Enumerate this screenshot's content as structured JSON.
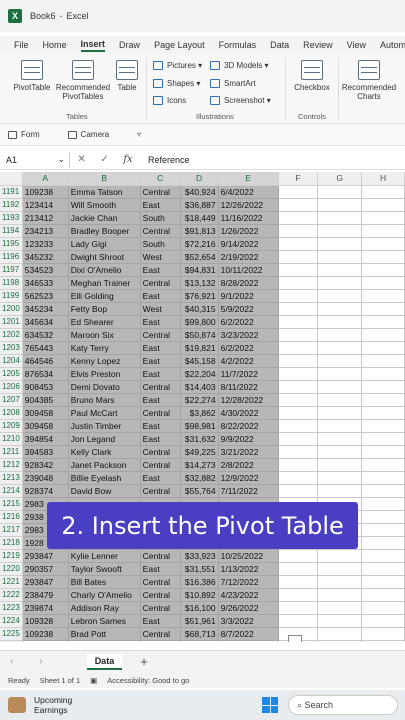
{
  "window": {
    "file_name": "Book6",
    "app_name": "Excel"
  },
  "tabs": [
    "File",
    "Home",
    "Insert",
    "Draw",
    "Page Layout",
    "Formulas",
    "Data",
    "Review",
    "View",
    "Automate"
  ],
  "active_tab": "Insert",
  "ribbon": {
    "pivot_table": "PivotTable",
    "recommended_pivot": "Recommended PivotTables",
    "table": "Table",
    "tables_group": "Tables",
    "pictures": "Pictures",
    "shapes": "Shapes",
    "icons": "Icons",
    "models_3d": "3D Models",
    "smartart": "SmartArt",
    "screenshot": "Screenshot",
    "illustrations_group": "Illustrations",
    "checkbox": "Checkbox",
    "controls_group": "Controls",
    "recommended_charts": "Recommended Charts"
  },
  "quick_bar": {
    "form": "Form",
    "camera": "Camera"
  },
  "formula_bar": {
    "name_box": "A1",
    "formula": "Reference"
  },
  "columns": [
    "A",
    "B",
    "C",
    "D",
    "E",
    "F",
    "G",
    "H"
  ],
  "rows": [
    {
      "n": "1191",
      "a": "109238",
      "b": "Emma Tatson",
      "c": "Central",
      "d": "$40,924",
      "e": "6/4/2022"
    },
    {
      "n": "1192",
      "a": "123414",
      "b": "Will Smooth",
      "c": "East",
      "d": "$36,887",
      "e": "12/26/2022"
    },
    {
      "n": "1193",
      "a": "213412",
      "b": "Jackie Chan",
      "c": "South",
      "d": "$18,449",
      "e": "11/16/2022"
    },
    {
      "n": "1194",
      "a": "234213",
      "b": "Bradley Booper",
      "c": "Central",
      "d": "$91,813",
      "e": "1/26/2022"
    },
    {
      "n": "1195",
      "a": "123233",
      "b": "Lady Gigi",
      "c": "South",
      "d": "$72,216",
      "e": "9/14/2022"
    },
    {
      "n": "1196",
      "a": "345232",
      "b": "Dwight Shroot",
      "c": "West",
      "d": "$52,654",
      "e": "2/19/2022"
    },
    {
      "n": "1197",
      "a": "534523",
      "b": "Dixi O'Amelio",
      "c": "East",
      "d": "$94,831",
      "e": "10/11/2022"
    },
    {
      "n": "1198",
      "a": "346533",
      "b": "Meghan Trainer",
      "c": "Central",
      "d": "$13,132",
      "e": "8/28/2022"
    },
    {
      "n": "1199",
      "a": "562523",
      "b": "Elli Golding",
      "c": "East",
      "d": "$76,921",
      "e": "9/1/2022"
    },
    {
      "n": "1200",
      "a": "345234",
      "b": "Fetty Bop",
      "c": "West",
      "d": "$40,315",
      "e": "5/9/2022"
    },
    {
      "n": "1201",
      "a": "345634",
      "b": "Ed Shearer",
      "c": "East",
      "d": "$99,800",
      "e": "6/2/2022"
    },
    {
      "n": "1202",
      "a": "634532",
      "b": "Maroon Six",
      "c": "Central",
      "d": "$50,874",
      "e": "3/23/2022"
    },
    {
      "n": "1203",
      "a": "765443",
      "b": "Katy Terry",
      "c": "East",
      "d": "$19,821",
      "e": "6/2/2022"
    },
    {
      "n": "1204",
      "a": "464546",
      "b": "Kenny Lopez",
      "c": "East",
      "d": "$45,158",
      "e": "4/2/2022"
    },
    {
      "n": "1205",
      "a": "876534",
      "b": "Elvis Preston",
      "c": "East",
      "d": "$22,204",
      "e": "11/7/2022"
    },
    {
      "n": "1206",
      "a": "908453",
      "b": "Demi Dovato",
      "c": "Central",
      "d": "$14,403",
      "e": "8/11/2022"
    },
    {
      "n": "1207",
      "a": "904385",
      "b": "Bruno Mars",
      "c": "East",
      "d": "$22,274",
      "e": "12/28/2022"
    },
    {
      "n": "1208",
      "a": "309458",
      "b": "Paul McCart",
      "c": "Central",
      "d": "$3,862",
      "e": "4/30/2022"
    },
    {
      "n": "1209",
      "a": "309458",
      "b": "Justin Timber",
      "c": "East",
      "d": "$98,981",
      "e": "8/22/2022"
    },
    {
      "n": "1210",
      "a": "394854",
      "b": "Jon Legand",
      "c": "East",
      "d": "$31,632",
      "e": "9/9/2022"
    },
    {
      "n": "1211",
      "a": "394583",
      "b": "Kelly Clark",
      "c": "Central",
      "d": "$49,225",
      "e": "3/21/2022"
    },
    {
      "n": "1212",
      "a": "928342",
      "b": "Janet Packson",
      "c": "Central",
      "d": "$14,273",
      "e": "2/8/2022"
    },
    {
      "n": "1213",
      "a": "239048",
      "b": "Billie Eyelash",
      "c": "East",
      "d": "$32,882",
      "e": "12/9/2022"
    },
    {
      "n": "1214",
      "a": "928374",
      "b": "David Bow",
      "c": "Central",
      "d": "$55,764",
      "e": "7/11/2022"
    },
    {
      "n": "1215",
      "a": "2983",
      "b": "",
      "c": "",
      "d": "",
      "e": ""
    },
    {
      "n": "1216",
      "a": "2938",
      "b": "",
      "c": "",
      "d": "",
      "e": ""
    },
    {
      "n": "1217",
      "a": "2983",
      "b": "",
      "c": "",
      "d": "",
      "e": ""
    },
    {
      "n": "1218",
      "a": "1928",
      "b": "",
      "c": "",
      "d": "",
      "e": ""
    },
    {
      "n": "1219",
      "a": "293847",
      "b": "Kylie Lenner",
      "c": "Central",
      "d": "$33,923",
      "e": "10/25/2022"
    },
    {
      "n": "1220",
      "a": "290357",
      "b": "Taylor Swooft",
      "c": "East",
      "d": "$31,551",
      "e": "1/13/2022"
    },
    {
      "n": "1221",
      "a": "293847",
      "b": "Bill Bates",
      "c": "Central",
      "d": "$16,386",
      "e": "7/12/2022"
    },
    {
      "n": "1222",
      "a": "238479",
      "b": "Charly O'Amelio",
      "c": "Central",
      "d": "$10,892",
      "e": "4/23/2022"
    },
    {
      "n": "1223",
      "a": "239874",
      "b": "Addison Ray",
      "c": "Central",
      "d": "$16,100",
      "e": "9/26/2022"
    },
    {
      "n": "1224",
      "a": "109328",
      "b": "Lebron Sames",
      "c": "East",
      "d": "$51,961",
      "e": "3/3/2022"
    },
    {
      "n": "1225",
      "a": "109238",
      "b": "Brad Pott",
      "c": "Central",
      "d": "$68,713",
      "e": "8/7/2022"
    },
    {
      "n": "1226",
      "a": "",
      "b": "",
      "c": "",
      "d": "",
      "e": ""
    }
  ],
  "banner": "2. Insert the Pivot Table",
  "sheet_tab": "Data",
  "status": {
    "ready": "Ready",
    "sheet": "Sheet 1 of 1",
    "accessibility": "Accessibility: Good to go"
  },
  "taskbar": {
    "weather_title": "Upcoming",
    "weather_sub": "Earnings",
    "search": "Search"
  }
}
